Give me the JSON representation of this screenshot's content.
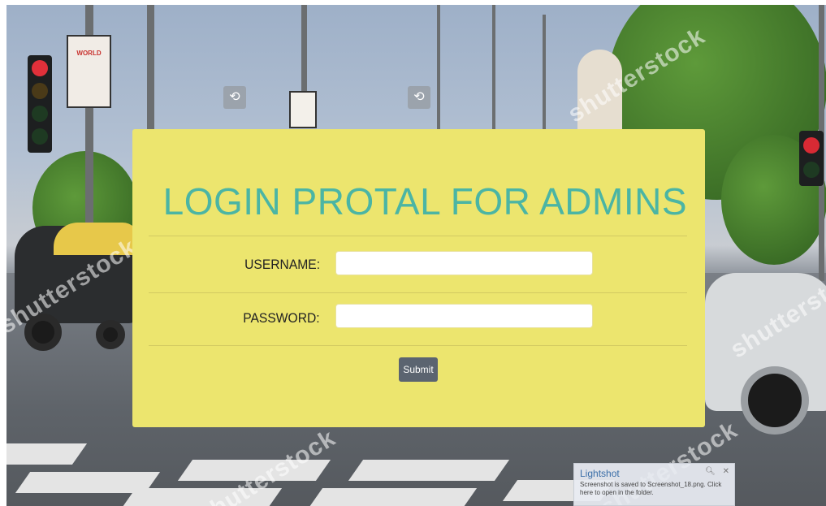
{
  "login": {
    "title": "LOGIN PROTAL FOR ADMINS",
    "username_label": "USERNAME:",
    "username_value": "",
    "password_label": "PASSWORD:",
    "password_value": "",
    "submit_label": "Submit"
  },
  "background": {
    "watermark_text": "shutterstock",
    "sign_text": "WORLD"
  },
  "toast": {
    "title": "Lightshot",
    "message": "Screenshot is saved to Screenshot_18.png. Click here to open in the folder.",
    "search_icon": "magnifier-icon",
    "close_icon": "close-icon",
    "search_glyph": "🔍︎",
    "close_glyph": "✕"
  },
  "colors": {
    "card_background": "#ece56e",
    "title_color": "#4bb5a4",
    "submit_background": "#5b6470"
  }
}
